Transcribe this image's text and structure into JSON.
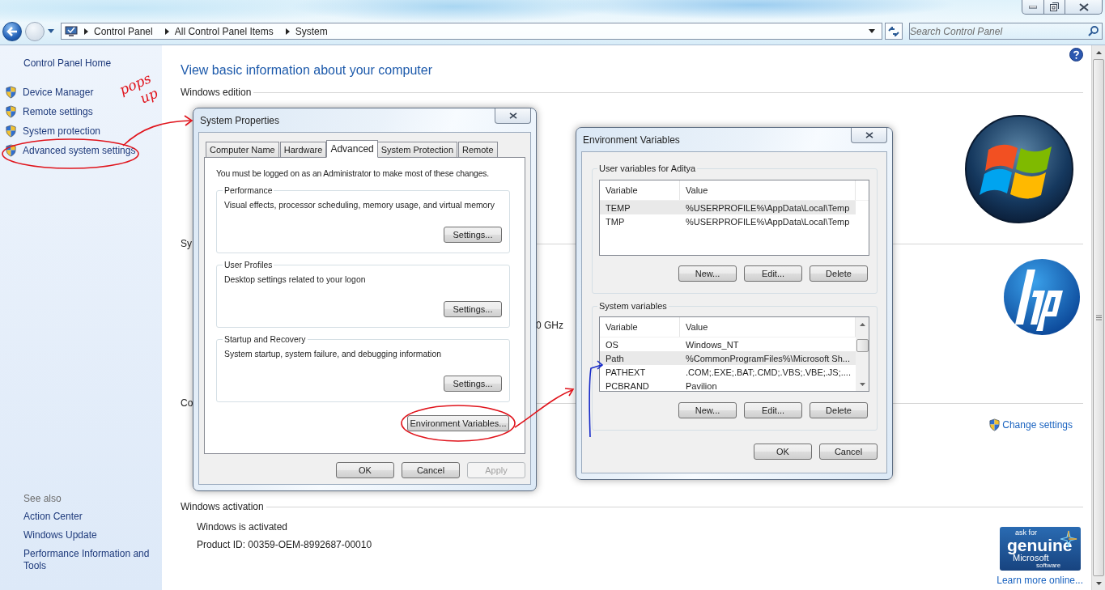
{
  "address_bar": {
    "crumbs": [
      "Control Panel",
      "All Control Panel Items",
      "System"
    ]
  },
  "search": {
    "placeholder": "Search Control Panel"
  },
  "sidebar": {
    "home": "Control Panel Home",
    "tasks": [
      "Device Manager",
      "Remote settings",
      "System protection",
      "Advanced system settings"
    ],
    "see_also_title": "See also",
    "see_also": [
      "Action Center",
      "Windows Update",
      "Performance Information and Tools"
    ]
  },
  "main": {
    "heading": "View basic information about your computer",
    "edition": {
      "title": "Windows edition"
    },
    "system": {
      "title": "Sy",
      "cpu_fragment": "0 GHz"
    },
    "computer": {
      "title": "Co",
      "link": "Change settings"
    },
    "activation": {
      "title": "Windows activation",
      "status": "Windows is activated",
      "product_id": "Product ID: 00359-OEM-8992687-00010",
      "badge": [
        "ask for",
        "genuine",
        "Microsoft",
        "software"
      ],
      "link": "Learn more online..."
    }
  },
  "system_properties": {
    "title": "System Properties",
    "tabs": [
      {
        "label": "Computer Name",
        "selected": false
      },
      {
        "label": "Hardware",
        "selected": false
      },
      {
        "label": "Advanced",
        "selected": true
      },
      {
        "label": "System Protection",
        "selected": false
      },
      {
        "label": "Remote",
        "selected": false
      }
    ],
    "notice": "You must be logged on as an Administrator to make most of these changes.",
    "groups": [
      {
        "title": "Performance",
        "description": "Visual effects, processor scheduling, memory usage, and virtual memory",
        "button": "Settings..."
      },
      {
        "title": "User Profiles",
        "description": "Desktop settings related to your logon",
        "button": "Settings..."
      },
      {
        "title": "Startup and Recovery",
        "description": "System startup, system failure, and debugging information",
        "button": "Settings..."
      }
    ],
    "env_button": "Environment Variables...",
    "buttons": [
      {
        "label": "OK",
        "disabled": false
      },
      {
        "label": "Cancel",
        "disabled": false
      },
      {
        "label": "Apply",
        "disabled": true
      }
    ]
  },
  "environment_variables": {
    "title": "Environment Variables",
    "groups": [
      {
        "title": "User variables for Aditya",
        "columns": [
          "Variable",
          "Value"
        ],
        "rows": [
          {
            "name": "TEMP",
            "value": "%USERPROFILE%\\AppData\\Local\\Temp",
            "selected": true
          },
          {
            "name": "TMP",
            "value": "%USERPROFILE%\\AppData\\Local\\Temp",
            "selected": false
          }
        ],
        "buttons": [
          "New...",
          "Edit...",
          "Delete"
        ]
      },
      {
        "title": "System variables",
        "columns": [
          "Variable",
          "Value"
        ],
        "rows": [
          {
            "name": "OS",
            "value": "Windows_NT",
            "selected": false
          },
          {
            "name": "Path",
            "value": "%CommonProgramFiles%\\Microsoft Sh...",
            "selected": true
          },
          {
            "name": "PATHEXT",
            "value": ".COM;.EXE;.BAT;.CMD;.VBS;.VBE;.JS;....",
            "selected": false
          },
          {
            "name": "PCBRAND",
            "value": "Pavilion",
            "selected": false
          }
        ],
        "buttons": [
          "New...",
          "Edit...",
          "Delete"
        ]
      }
    ],
    "buttons": [
      "OK",
      "Cancel"
    ]
  },
  "annotation": {
    "note": "pops up"
  }
}
